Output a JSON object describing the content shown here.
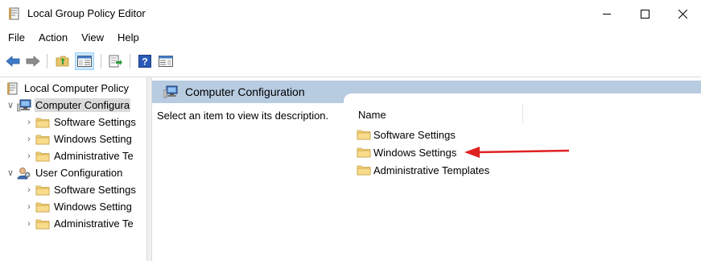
{
  "window": {
    "title": "Local Group Policy Editor"
  },
  "menu": [
    "File",
    "Action",
    "View",
    "Help"
  ],
  "tree": {
    "root": "Local Computer Policy",
    "computer": {
      "label": "Computer Configura",
      "children": [
        "Software Settings",
        "Windows Setting",
        "Administrative Te"
      ]
    },
    "user": {
      "label": "User Configuration",
      "children": [
        "Software Settings",
        "Windows Setting",
        "Administrative Te"
      ]
    }
  },
  "main": {
    "header": "Computer Configuration",
    "description": "Select an item to view its description.",
    "column_name": "Name",
    "items": [
      "Software Settings",
      "Windows Settings",
      "Administrative Templates"
    ]
  },
  "colors": {
    "header_band": "#b7cbe1",
    "annotation_arrow": "#e02020",
    "folder": "#e8c46a"
  }
}
